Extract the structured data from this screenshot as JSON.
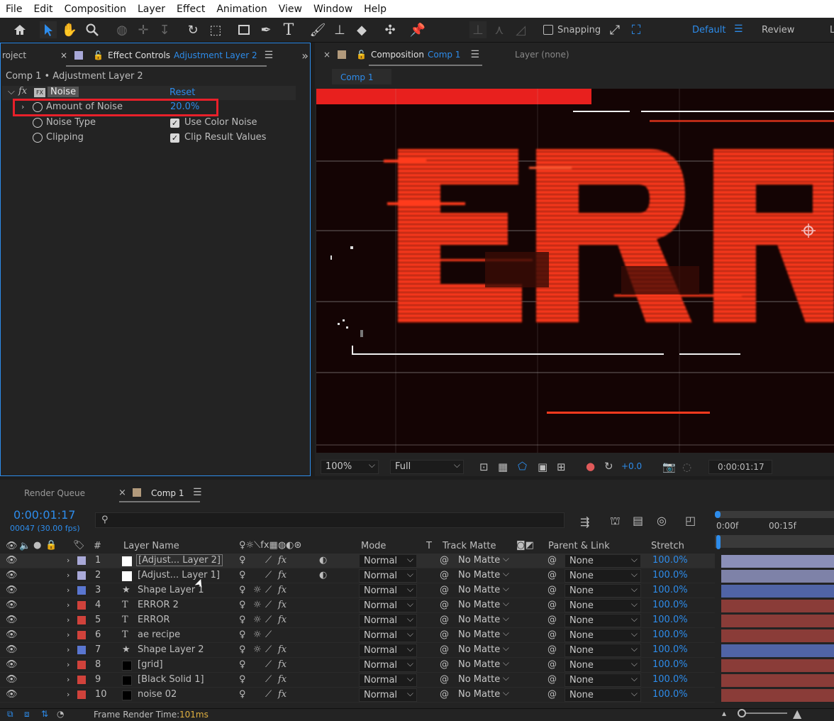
{
  "menu": [
    "File",
    "Edit",
    "Composition",
    "Layer",
    "Effect",
    "Animation",
    "View",
    "Window",
    "Help"
  ],
  "toolbar": {
    "snapping_label": "Snapping",
    "workspace_default": "Default",
    "workspace_review": "Review",
    "workspace_more": "L"
  },
  "left_panel": {
    "project_tab": "roject",
    "effect_controls_tab": "Effect Controls",
    "effect_controls_layer": "Adjustment Layer 2",
    "breadcrumb": "Comp 1 • Adjustment Layer 2",
    "effect_name": "Noise",
    "reset_label": "Reset",
    "params": [
      {
        "name": "Amount of Noise",
        "value": "20.0%"
      },
      {
        "name": "Noise Type",
        "value": "Use Color Noise"
      },
      {
        "name": "Clipping",
        "value": "Clip Result Values"
      }
    ]
  },
  "viewer": {
    "composition_label": "Composition",
    "composition_name": "Comp 1",
    "layer_tab": "Layer (none)",
    "comp_tab": "Comp 1",
    "zoom": "100%",
    "resolution": "Full",
    "exposure": "+0.0",
    "timecode": "0:00:01:17"
  },
  "timeline": {
    "render_queue_tab": "Render Queue",
    "comp_tab": "Comp 1",
    "timecode": "0:00:01:17",
    "frames": "00047 (30.00 fps)",
    "search_placeholder": "",
    "ruler": [
      "0:00f",
      "00:15f"
    ],
    "columns": {
      "num": "#",
      "layer_name": "Layer Name",
      "mode": "Mode",
      "t": "T",
      "track_matte": "Track Matte",
      "parent": "Parent & Link",
      "stretch": "Stretch"
    },
    "layers": [
      {
        "num": "1",
        "name": "[Adjust... Layer 2]",
        "mode": "Normal",
        "matte": "No Matte",
        "parent": "None",
        "stretch": "100.0%",
        "label": "#a9a9d8",
        "bar": "#8b8fb8",
        "type": "adjust"
      },
      {
        "num": "2",
        "name": "[Adjust... Layer 1]",
        "mode": "Normal",
        "matte": "No Matte",
        "parent": "None",
        "stretch": "100.0%",
        "label": "#a9a9d8",
        "bar": "#7e82a8",
        "type": "adjust"
      },
      {
        "num": "3",
        "name": "Shape Layer 1",
        "mode": "Normal",
        "matte": "No Matte",
        "parent": "None",
        "stretch": "100.0%",
        "label": "#5a76d0",
        "bar": "#5064a6",
        "type": "shape"
      },
      {
        "num": "4",
        "name": "ERROR 2",
        "mode": "Normal",
        "matte": "No Matte",
        "parent": "None",
        "stretch": "100.0%",
        "label": "#d0423b",
        "bar": "#8a3c38",
        "type": "text"
      },
      {
        "num": "5",
        "name": "ERROR",
        "mode": "Normal",
        "matte": "No Matte",
        "parent": "None",
        "stretch": "100.0%",
        "label": "#d0423b",
        "bar": "#8a3c38",
        "type": "text"
      },
      {
        "num": "6",
        "name": "ae recipe",
        "mode": "Normal",
        "matte": "No Matte",
        "parent": "None",
        "stretch": "100.0%",
        "label": "#d0423b",
        "bar": "#8a3c38",
        "type": "text"
      },
      {
        "num": "7",
        "name": "Shape Layer 2",
        "mode": "Normal",
        "matte": "No Matte",
        "parent": "None",
        "stretch": "100.0%",
        "label": "#5a76d0",
        "bar": "#5064a6",
        "type": "shape"
      },
      {
        "num": "8",
        "name": "[grid]",
        "mode": "Normal",
        "matte": "No Matte",
        "parent": "None",
        "stretch": "100.0%",
        "label": "#d0423b",
        "bar": "#8a3c38",
        "type": "solid"
      },
      {
        "num": "9",
        "name": "[Black Solid 1]",
        "mode": "Normal",
        "matte": "No Matte",
        "parent": "None",
        "stretch": "100.0%",
        "label": "#d0423b",
        "bar": "#8a3c38",
        "type": "solid"
      },
      {
        "num": "10",
        "name": "noise 02",
        "mode": "Normal",
        "matte": "No Matte",
        "parent": "None",
        "stretch": "100.0%",
        "label": "#d0423b",
        "bar": "#8a3c38",
        "type": "solid"
      }
    ],
    "status_label": "Frame Render Time:",
    "status_value": "101ms"
  },
  "colors": {
    "accent": "#2d8ceb",
    "highlight_box": "#e8202a",
    "canvas_red": "#ff3a1e"
  }
}
